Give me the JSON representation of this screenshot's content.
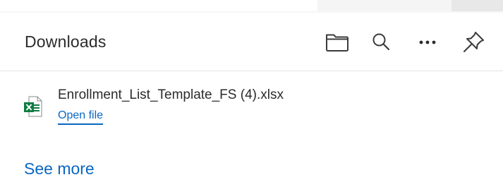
{
  "panel": {
    "title": "Downloads"
  },
  "toolbar": {
    "icons": [
      "folder-icon",
      "search-icon",
      "more-options-icon",
      "pin-icon"
    ]
  },
  "downloads": [
    {
      "file_name": "Enrollment_List_Template_FS (4).xlsx",
      "action_label": "Open file",
      "file_icon": "excel-file-icon"
    }
  ],
  "footer": {
    "see_more_label": "See more"
  },
  "colors": {
    "link": "#0a67c2",
    "text": "#2b2b2b",
    "excel_green": "#107c41"
  }
}
